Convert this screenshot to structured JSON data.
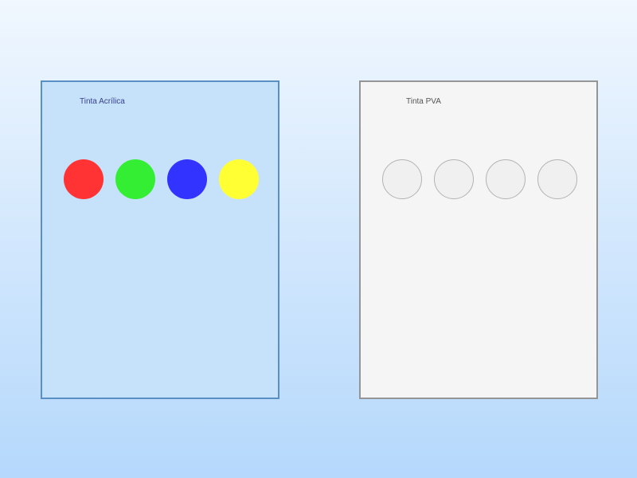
{
  "panels": [
    {
      "label": "Tinta Acrílica",
      "swatches": [
        {
          "color": "#ff3333"
        },
        {
          "color": "#33ee33"
        },
        {
          "color": "#3333ff"
        },
        {
          "color": "#ffff33"
        }
      ]
    },
    {
      "label": "Tinta PVA",
      "swatches": [
        {
          "color": "#f0f0f0"
        },
        {
          "color": "#f0f0f0"
        },
        {
          "color": "#f0f0f0"
        },
        {
          "color": "#f0f0f0"
        }
      ]
    }
  ]
}
